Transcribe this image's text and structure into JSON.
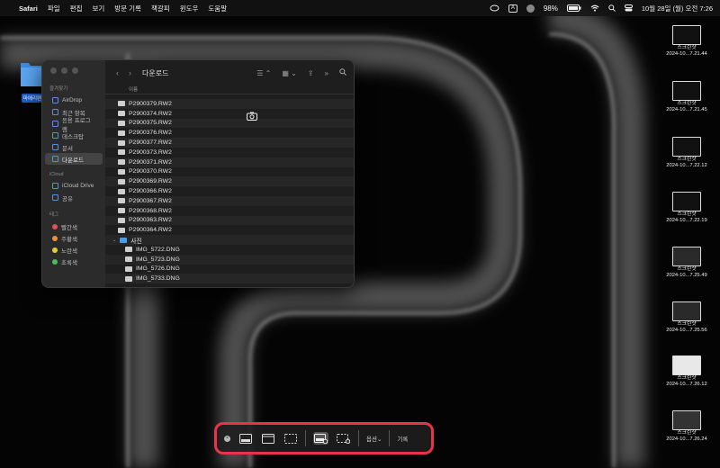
{
  "menubar": {
    "app_name": "Safari",
    "menus": [
      "파일",
      "편집",
      "보기",
      "방문 기록",
      "책갈피",
      "윈도우",
      "도움말"
    ],
    "input_source": "A",
    "battery": "98%",
    "datetime": "10월 28일 (월) 오전 7:26"
  },
  "desktop_folder": {
    "label": "마에리팬"
  },
  "finder": {
    "title": "다운로드",
    "column_header": "이름",
    "sidebar": {
      "favorites_header": "즐겨찾기",
      "favorites": [
        "AirDrop",
        "최근 항목",
        "응용 프로그램",
        "데스크탑",
        "문서",
        "다운로드"
      ],
      "icloud_header": "iCloud",
      "icloud": [
        "iCloud Drive",
        "공유"
      ],
      "tags_header": "태그",
      "tags": [
        {
          "label": "빨간색",
          "color": "#e05252"
        },
        {
          "label": "주황색",
          "color": "#e8923a"
        },
        {
          "label": "노란색",
          "color": "#e8c93a"
        },
        {
          "label": "초록색",
          "color": "#4cbb5a"
        }
      ]
    },
    "files": [
      "P2900379.RW2",
      "P2900374.RW2",
      "P2900375.RW2",
      "P2900376.RW2",
      "P2900377.RW2",
      "P2900373.RW2",
      "P2900371.RW2",
      "P2900370.RW2",
      "P2900369.RW2",
      "P2900366.RW2",
      "P2900367.RW2",
      "P2900368.RW2",
      "P2900363.RW2",
      "P2900364.RW2"
    ],
    "folder_name": "사진",
    "subfiles": [
      "IMG_5722.DNG",
      "IMG_5723.DNG",
      "IMG_5726.DNG",
      "IMG_5733.DNG"
    ]
  },
  "screenshots": [
    {
      "name": "스크린샷",
      "stamp": "2024-10...7.21.44"
    },
    {
      "name": "스크린샷",
      "stamp": "2024-10...7.21.45"
    },
    {
      "name": "스크린샷",
      "stamp": "2024-10...7.22.12"
    },
    {
      "name": "스크린샷",
      "stamp": "2024-10...7.22.19"
    },
    {
      "name": "스크린샷",
      "stamp": "2024-10...7.25.49"
    },
    {
      "name": "스크린샷",
      "stamp": "2024-10...7.25.56"
    },
    {
      "name": "스크린샷",
      "stamp": "2024-10...7.26.12"
    },
    {
      "name": "스크린샷",
      "stamp": "2024-10...7.26.24"
    }
  ],
  "capture_bar": {
    "options_label": "옵션",
    "record_label": "기록",
    "highlight_color": "#e8334b"
  }
}
